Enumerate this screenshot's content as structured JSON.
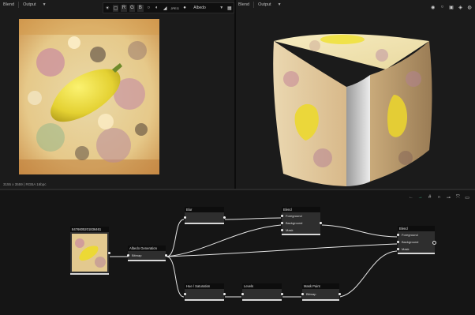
{
  "left_view": {
    "tab1": "Blend",
    "tab2": "Output",
    "status": "3155 x 3559 | RGBA 16bpc"
  },
  "right_view": {
    "tab1": "Blend",
    "tab2": "Output"
  },
  "channel_toolbar": {
    "r": "R",
    "g": "G",
    "b": "B",
    "format": "JPEG",
    "channel": "Albedo"
  },
  "nodes": {
    "image": {
      "title": "8476605201836461"
    },
    "albedo": {
      "title": "Albedo Generation",
      "slot": "Bitmap"
    },
    "blur": {
      "title": "Blur"
    },
    "blend1": {
      "title": "Blend",
      "slots": [
        "Foreground",
        "Background",
        "Mask"
      ]
    },
    "blend2": {
      "title": "Blend",
      "slots": [
        "Foreground",
        "Background",
        "Mask"
      ]
    },
    "hue": {
      "title": "Hue / Saturation"
    },
    "levels": {
      "title": "Levels"
    },
    "mask": {
      "title": "Mask Paint",
      "slot": "Bitmap"
    }
  },
  "colors": {
    "bg": "#161616",
    "node_body": "#2e2e2e",
    "wire": "#e6e6e6",
    "pizza_yellow": "#e8d23a"
  }
}
